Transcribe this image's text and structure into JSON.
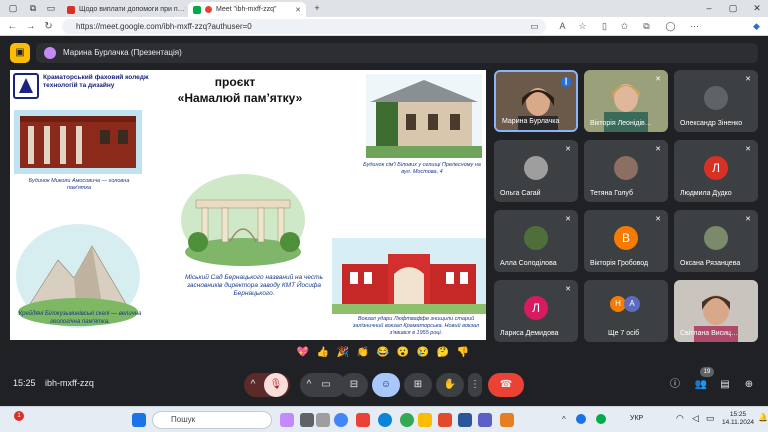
{
  "browser": {
    "tabs": [
      {
        "title": "Щодо виплати допомоги при п…",
        "active": false
      },
      {
        "title": "Meet \"ibh-mxff-zzq\"",
        "active": true
      }
    ],
    "url": "https://meet.google.com/ibh-mxff-zzq?authuser=0"
  },
  "meet": {
    "presenter_label": "Марина Бурлачка (Презентація)",
    "slide": {
      "college_name": "Краматорський фаховий коледж технологій та дизайну",
      "title": "проєкт",
      "subtitle": "«Намалюй пам’ятку»",
      "captions": {
        "building": "Будинок сім'ї Білових у селищі Прелесному на вул. Мостова, 4",
        "mansion": "Будинок Миколи Амосовича — головна пам'ятка",
        "garden": "Міський Сад Бернацького названий на честь засновників директора заводу КМТ Йосифа Бернацького.",
        "rocks": "Крейдяні Білокузьминівські скелі — велична геологічна пам'ятка.",
        "station": "Вокзал удари Люфтваффе знищили старий залізничний вокзал Краматорська. Новий вокзал з'явився в 1955 році."
      }
    },
    "participants": [
      {
        "name": "Марина Бурлачка",
        "type": "video",
        "muted": false,
        "speaking": true
      },
      {
        "name": "Вікторія Леонідів…",
        "type": "video",
        "muted": true
      },
      {
        "name": "Олександр Зіненко",
        "type": "avatar",
        "initial": "",
        "color": "#5f6368",
        "muted": true
      },
      {
        "name": "Ольга Сагай",
        "type": "avatar",
        "initial": "",
        "color": "#9e9e9e",
        "muted": true
      },
      {
        "name": "Тетяна Голуб",
        "type": "avatar",
        "initial": "",
        "color": "#8d6e63",
        "muted": true
      },
      {
        "name": "Людмила Дудко",
        "type": "avatar",
        "initial": "Л",
        "color": "#d93025",
        "muted": true
      },
      {
        "name": "Алла Солоділова",
        "type": "avatar",
        "initial": "",
        "color": "#4e6e3a",
        "muted": true
      },
      {
        "name": "Вікторія Гробовод",
        "type": "avatar",
        "initial": "В",
        "color": "#f57c00",
        "muted": true
      },
      {
        "name": "Оксана Рязанцева",
        "type": "avatar",
        "initial": "",
        "color": "#7a8a6a",
        "muted": true
      },
      {
        "name": "Лариса Демидова",
        "type": "avatar",
        "initial": "Л",
        "color": "#d81b60",
        "muted": true
      },
      {
        "name": "Ще 7 осіб",
        "type": "more",
        "initials": [
          "Н",
          "А"
        ],
        "colors": [
          "#f57c00",
          "#5c6bc0"
        ]
      },
      {
        "name": "Світлана Висиц…",
        "type": "video",
        "muted": false
      }
    ],
    "reactions": [
      "💖",
      "👍",
      "🎉",
      "👏",
      "😂",
      "😮",
      "😢",
      "🤔",
      "👎"
    ],
    "clock": "15:25",
    "meeting_code": "ibh-mxff-zzq",
    "participant_count": "19"
  },
  "taskbar": {
    "search_placeholder": "Пошук",
    "language": "УКР",
    "time": "15:25",
    "date": "14.11.2024",
    "notification_count": "1"
  }
}
